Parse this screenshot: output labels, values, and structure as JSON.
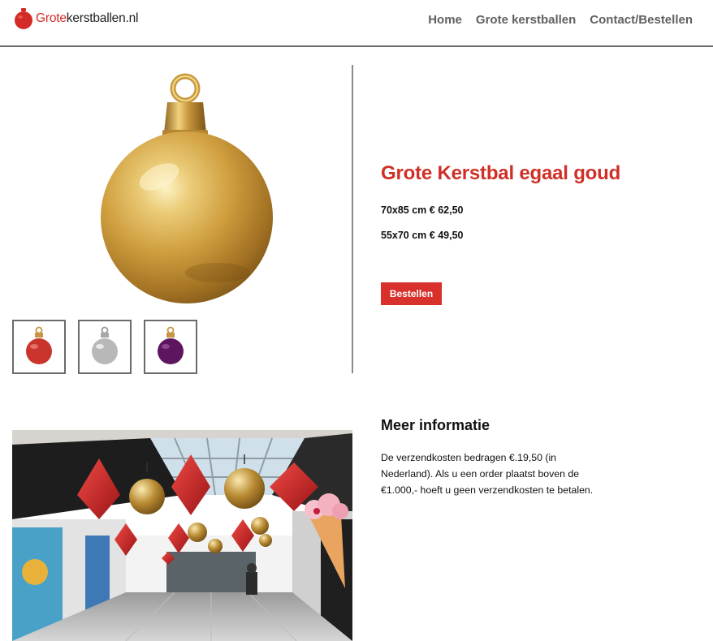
{
  "header": {
    "logo": {
      "text_red": "Grote",
      "text_dark": "kerstballen.nl",
      "icon": "christmas-ball-icon"
    },
    "nav": {
      "items": [
        {
          "label": "Home"
        },
        {
          "label": "Grote kerstballen"
        },
        {
          "label": "Contact/Bestellen"
        }
      ]
    }
  },
  "product": {
    "title": "Grote Kerstbal egaal goud",
    "prices": [
      {
        "text": "70x85 cm € 62,50"
      },
      {
        "text": "55x70 cm € 49,50"
      }
    ],
    "order_button": "Bestellen",
    "thumbnails": [
      {
        "color": "#c9342c"
      },
      {
        "color": "#b8b8b8"
      },
      {
        "color": "#5e1560"
      }
    ]
  },
  "info": {
    "heading": "Meer informatie",
    "lines": [
      "De verzendkosten bedragen €.19,50 (in",
      "Nederland). Als u een order plaatst boven de",
      "€1.000,- hoeft u geen verzendkosten te betalen."
    ]
  },
  "colors": {
    "brand_red": "#d52b27",
    "nav_gray": "#606060",
    "gold": "#c99a3a"
  }
}
